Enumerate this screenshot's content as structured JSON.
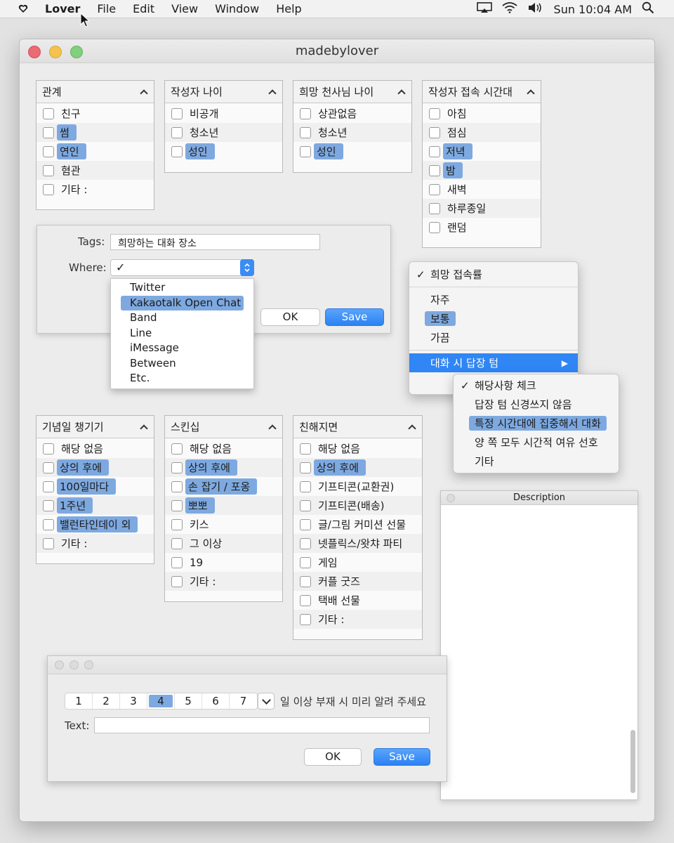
{
  "menubar": {
    "app": "Lover",
    "items": [
      "File",
      "Edit",
      "View",
      "Window",
      "Help"
    ],
    "clock": "Sun 10:04 AM"
  },
  "window": {
    "title": "madebylover"
  },
  "panels": {
    "relation": {
      "title": "관계",
      "items": [
        {
          "label": "친구",
          "hl": false
        },
        {
          "label": "썸",
          "hl": true
        },
        {
          "label": "연인",
          "hl": true
        },
        {
          "label": "혐관",
          "hl": false
        },
        {
          "label": "기타 :",
          "hl": false
        }
      ]
    },
    "author_age": {
      "title": "작성자 나이",
      "items": [
        {
          "label": "비공개",
          "hl": false
        },
        {
          "label": "청소년",
          "hl": false
        },
        {
          "label": "성인",
          "hl": true
        }
      ]
    },
    "angel_age": {
      "title": "희망 천사님 나이",
      "items": [
        {
          "label": "상관없음",
          "hl": false
        },
        {
          "label": "청소년",
          "hl": false
        },
        {
          "label": "성인",
          "hl": true
        }
      ]
    },
    "time": {
      "title": "작성자 접속 시간대",
      "items": [
        {
          "label": "아침",
          "hl": false
        },
        {
          "label": "점심",
          "hl": false
        },
        {
          "label": "저녁",
          "hl": true
        },
        {
          "label": "밤",
          "hl": true
        },
        {
          "label": "새벽",
          "hl": false
        },
        {
          "label": "하루종일",
          "hl": false
        },
        {
          "label": "랜덤",
          "hl": false
        }
      ]
    },
    "anniversary": {
      "title": "기념일 챙기기",
      "items": [
        {
          "label": "해당 없음",
          "hl": false
        },
        {
          "label": "상의 후에",
          "hl": true
        },
        {
          "label": "100일마다",
          "hl": true
        },
        {
          "label": "1주년",
          "hl": true
        },
        {
          "label": "밸런타인데이 외",
          "hl": true
        },
        {
          "label": "기타 :",
          "hl": false
        }
      ]
    },
    "skinship": {
      "title": "스킨십",
      "items": [
        {
          "label": "해당 없음",
          "hl": false
        },
        {
          "label": "상의 후에",
          "hl": true
        },
        {
          "label": "손 잡기 / 포옹",
          "hl": true
        },
        {
          "label": "뽀뽀",
          "hl": true
        },
        {
          "label": "키스",
          "hl": false
        },
        {
          "label": "그 이상",
          "hl": false
        },
        {
          "label": "19",
          "hl": false
        },
        {
          "label": "기타 :",
          "hl": false
        }
      ]
    },
    "closer": {
      "title": "친해지면",
      "items": [
        {
          "label": "해당 없음",
          "hl": false
        },
        {
          "label": "상의 후에",
          "hl": true
        },
        {
          "label": "기프티콘(교환권)",
          "hl": false
        },
        {
          "label": "기프티콘(배송)",
          "hl": false
        },
        {
          "label": "글/그림 커미션 선물",
          "hl": false
        },
        {
          "label": "넷플릭스/왓챠 파티",
          "hl": false
        },
        {
          "label": "게임",
          "hl": false
        },
        {
          "label": "커플 굿즈",
          "hl": false
        },
        {
          "label": "택배 선물",
          "hl": false
        },
        {
          "label": "기타 :",
          "hl": false
        }
      ]
    }
  },
  "dialog": {
    "tags_label": "Tags:",
    "tags_value": "희망하는 대화 장소",
    "where_label": "Where:",
    "where_value": "✓",
    "ok": "OK",
    "save": "Save",
    "options": [
      {
        "label": "Twitter",
        "sel": false
      },
      {
        "label": "Kakaotalk Open Chat",
        "sel": true
      },
      {
        "label": "Band",
        "sel": false
      },
      {
        "label": "Line",
        "sel": false
      },
      {
        "label": "iMessage",
        "sel": false
      },
      {
        "label": "Between",
        "sel": false
      },
      {
        "label": "Etc.",
        "sel": false
      }
    ]
  },
  "menu": {
    "header": "희망 접속률",
    "items": [
      "자주",
      "보통",
      "가끔"
    ],
    "highlighted": "보통",
    "submenu_label": "대화 시 답장 텀",
    "submenu": {
      "header": "해당사항 체크",
      "items": [
        "답장 텀 신경쓰지 않음",
        "특정 시간대에 집중해서 대화",
        "양 쪽 모두 시간적 여유 선호",
        "기타"
      ],
      "highlighted": "특정 시간대에 집중해서 대화"
    }
  },
  "description": {
    "title": "Description"
  },
  "bottom": {
    "segments": [
      "1",
      "2",
      "3",
      "4",
      "5",
      "6",
      "7"
    ],
    "selected": "4",
    "suffix": "일 이상 부재 시 미리 알려 주세요",
    "text_label": "Text:",
    "ok": "OK",
    "save": "Save"
  }
}
